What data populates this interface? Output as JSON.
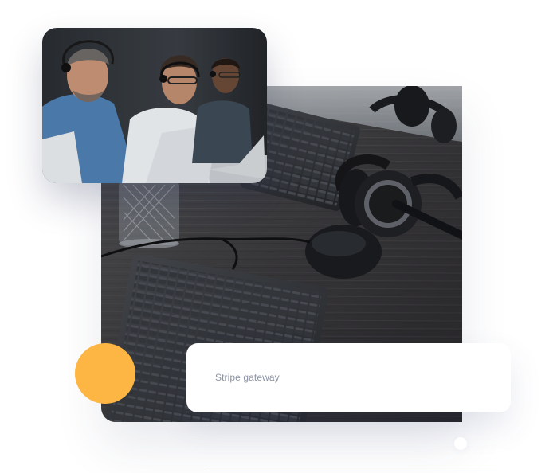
{
  "card": {
    "label": "Stripe gateway"
  },
  "images": {
    "main": "desk-keyboards-headsets-photo",
    "overlay": "call-center-agents-photo"
  },
  "colors": {
    "accent": "#fdb644",
    "card_text": "#8b93a3",
    "background": "#ffffff"
  }
}
